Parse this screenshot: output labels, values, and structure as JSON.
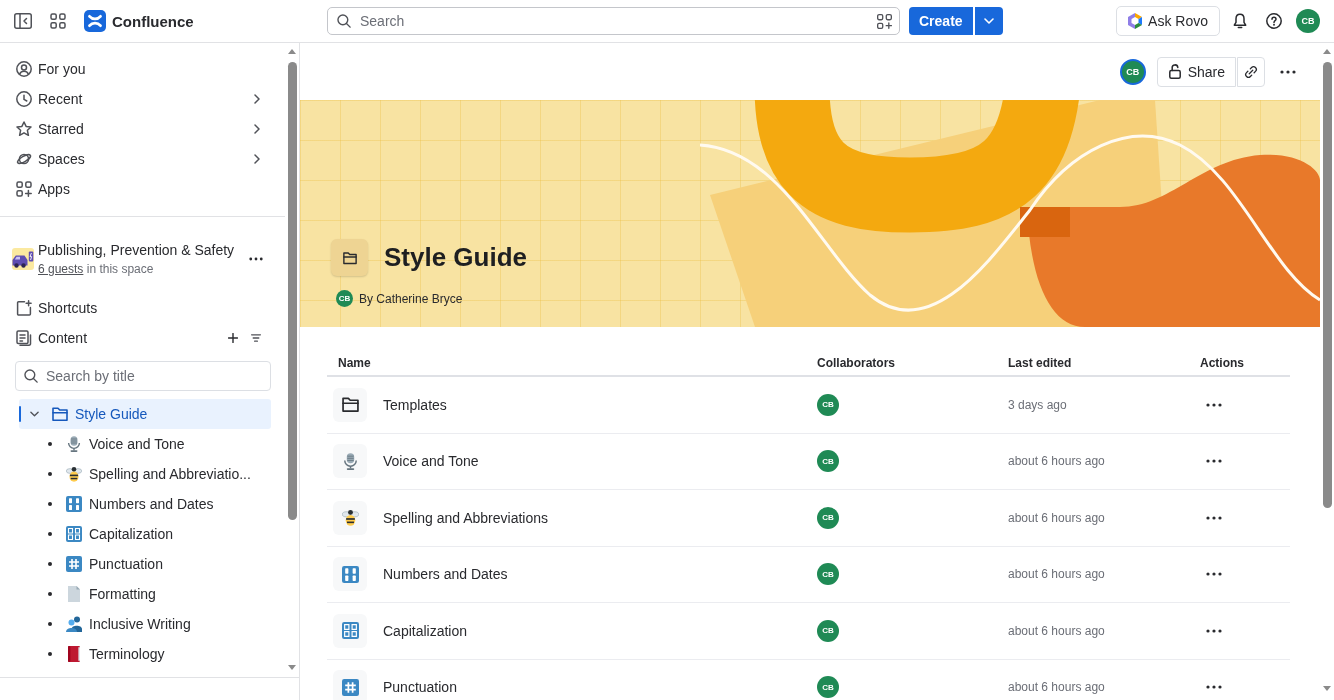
{
  "top_bar": {
    "product_name": "Confluence",
    "search": {
      "placeholder": "Search"
    },
    "create_button": "Create",
    "ask_button": "Ask Rovo",
    "avatar": "CB"
  },
  "sidebar": {
    "nav": [
      {
        "label": "For you",
        "kind": "person",
        "has_submenu": false
      },
      {
        "label": "Recent",
        "kind": "clock",
        "has_submenu": true
      },
      {
        "label": "Starred",
        "kind": "star",
        "has_submenu": true
      },
      {
        "label": "Spaces",
        "kind": "planet",
        "has_submenu": true
      },
      {
        "label": "Apps",
        "kind": "apps",
        "has_submenu": false
      }
    ],
    "space": {
      "name": "Publishing, Prevention & Safety",
      "guests_link": "6 guests",
      "guests_note": "in this space"
    },
    "sections": [
      {
        "label": "Shortcuts",
        "kind": "shortcut",
        "has_actions": false
      },
      {
        "label": "Content",
        "kind": "document",
        "has_actions": true
      }
    ],
    "tree_search": {
      "placeholder": "Search by title"
    },
    "tree": [
      {
        "label": "Style Guide",
        "kind": "folder",
        "selected": true,
        "expanded": true,
        "children": [
          {
            "label": "Voice and Tone",
            "kind": "microphone",
            "selected": false
          },
          {
            "label": "Spelling and Abbreviatio...",
            "kind": "bee",
            "selected": false
          },
          {
            "label": "Numbers and Dates",
            "kind": "numbers",
            "selected": false
          },
          {
            "label": "Capitalization",
            "kind": "letters",
            "selected": false
          },
          {
            "label": "Punctuation",
            "kind": "hash",
            "selected": false
          },
          {
            "label": "Formatting",
            "kind": "page",
            "selected": false
          },
          {
            "label": "Inclusive Writing",
            "kind": "people",
            "selected": false
          },
          {
            "label": "Terminology",
            "kind": "book",
            "selected": false
          }
        ]
      }
    ]
  },
  "page": {
    "viewer_avatar": "CB",
    "share_button": "Share",
    "title": "Style Guide",
    "author_avatar": "CB",
    "byline": "By Catherine Bryce"
  },
  "table": {
    "columns": [
      "Name",
      "Collaborators",
      "Last edited",
      "Actions"
    ],
    "rows": [
      {
        "kind": "folder",
        "name": "Templates",
        "collaborator": "CB",
        "last_edited": "3 days ago"
      },
      {
        "kind": "microphone",
        "name": "Voice and Tone",
        "collaborator": "CB",
        "last_edited": "about 6 hours ago"
      },
      {
        "kind": "bee",
        "name": "Spelling and Abbreviations",
        "collaborator": "CB",
        "last_edited": "about 6 hours ago"
      },
      {
        "kind": "numbers",
        "name": "Numbers and Dates",
        "collaborator": "CB",
        "last_edited": "about 6 hours ago"
      },
      {
        "kind": "letters",
        "name": "Capitalization",
        "collaborator": "CB",
        "last_edited": "about 6 hours ago"
      },
      {
        "kind": "hash",
        "name": "Punctuation",
        "collaborator": "CB",
        "last_edited": "about 6 hours ago"
      }
    ]
  }
}
